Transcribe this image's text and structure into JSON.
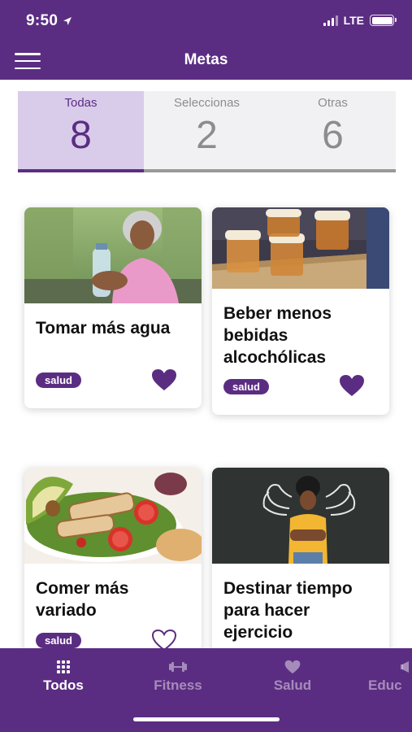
{
  "status_bar": {
    "time": "9:50",
    "network": "LTE",
    "signal_icon": "signal-icon",
    "battery_icon": "battery-icon",
    "location_icon": "location-arrow-icon"
  },
  "header": {
    "title": "Metas",
    "menu_icon": "hamburger-menu-icon"
  },
  "filter_tabs": [
    {
      "label": "Todas",
      "count": "8",
      "active": true
    },
    {
      "label": "Seleccionas",
      "count": "2",
      "active": false
    },
    {
      "label": "Otras",
      "count": "6",
      "active": false
    }
  ],
  "cards": [
    {
      "title": "Tomar más agua",
      "tag": "salud",
      "favorited": true,
      "image": "woman-drinking-water-photo"
    },
    {
      "title": "Beber menos bebidas alcochólicas",
      "tag": "salud",
      "favorited": true,
      "image": "beer-glasses-photo"
    },
    {
      "title": "Comer más variado",
      "tag": "salud",
      "favorited": false,
      "image": "salad-with-chicken-photo"
    },
    {
      "title": "Destinar tiempo para hacer ejercicio",
      "tag": "",
      "favorited": false,
      "image": "woman-arms-crossed-chalkboard-muscles-photo"
    }
  ],
  "bottom_nav": [
    {
      "label": "Todos",
      "icon": "grid-icon",
      "active": true
    },
    {
      "label": "Fitness",
      "icon": "dumbbell-icon",
      "active": false
    },
    {
      "label": "Salud",
      "icon": "heart-icon",
      "active": false
    },
    {
      "label": "Educ",
      "icon": "megaphone-icon",
      "active": false
    }
  ],
  "colors": {
    "brand": "#5b2d82",
    "tab_active_bg": "#d9ccea",
    "inactive_text": "#8c8c8c"
  }
}
